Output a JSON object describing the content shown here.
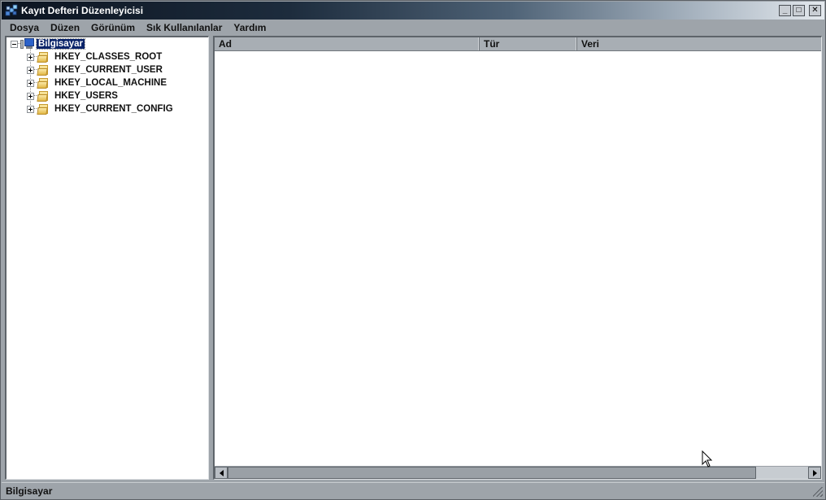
{
  "window": {
    "title": "Kayıt Defteri Düzenleyicisi",
    "controls": {
      "minimize": "_",
      "maximize": "□",
      "close": "✕"
    }
  },
  "menu": [
    {
      "label": "Dosya"
    },
    {
      "label": "Düzen"
    },
    {
      "label": "Görünüm"
    },
    {
      "label": "Sık Kullanılanlar"
    },
    {
      "label": "Yardım"
    }
  ],
  "tree": {
    "root": {
      "label": "Bilgisayar",
      "icon": "computer-icon",
      "expanded": true,
      "selected": true
    },
    "children": [
      {
        "label": "HKEY_CLASSES_ROOT",
        "icon": "folder-icon"
      },
      {
        "label": "HKEY_CURRENT_USER",
        "icon": "folder-icon"
      },
      {
        "label": "HKEY_LOCAL_MACHINE",
        "icon": "folder-icon"
      },
      {
        "label": "HKEY_USERS",
        "icon": "folder-icon"
      },
      {
        "label": "HKEY_CURRENT_CONFIG",
        "icon": "folder-icon"
      }
    ]
  },
  "list": {
    "columns": [
      {
        "label": "Ad"
      },
      {
        "label": "Tür"
      },
      {
        "label": "Veri"
      }
    ],
    "rows": []
  },
  "statusbar": {
    "path": "Bilgisayar"
  },
  "colors": {
    "window_bg": "#9ea4aa",
    "selection": "#0a246a",
    "titlebar_dark": "#0c1420",
    "titlebar_light": "#e4e9ee"
  }
}
